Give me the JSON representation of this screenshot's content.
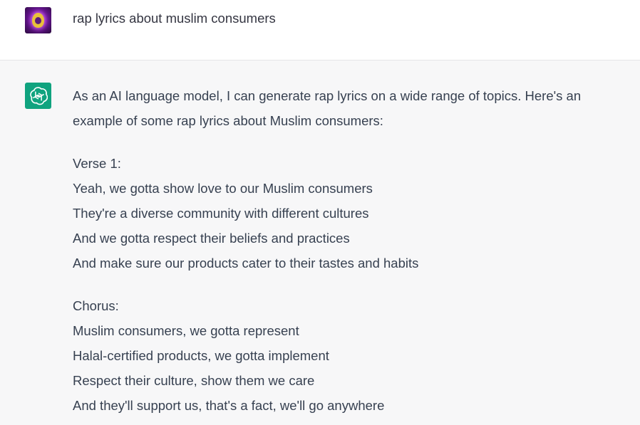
{
  "user_message": {
    "avatar_icon": "purple-glowing-avatar-icon",
    "text": "rap lyrics about muslim consumers"
  },
  "assistant_message": {
    "avatar_icon": "openai-logo-icon",
    "avatar_color": "#10a37f",
    "intro_line_1": "As an AI language model, I can generate rap lyrics on a wide range of topics. Here's an",
    "intro_line_2": "example of some rap lyrics about Muslim consumers:",
    "verse": {
      "heading": "Verse 1:",
      "lines": [
        "Yeah, we gotta show love to our Muslim consumers",
        "They're a diverse community with different cultures",
        "And we gotta respect their beliefs and practices",
        "And make sure our products cater to their tastes and habits"
      ]
    },
    "chorus": {
      "heading": "Chorus:",
      "lines": [
        "Muslim consumers, we gotta represent",
        "Halal-certified products, we gotta implement",
        "Respect their culture, show them we care",
        "And they'll support us, that's a fact, we'll go anywhere"
      ]
    }
  }
}
